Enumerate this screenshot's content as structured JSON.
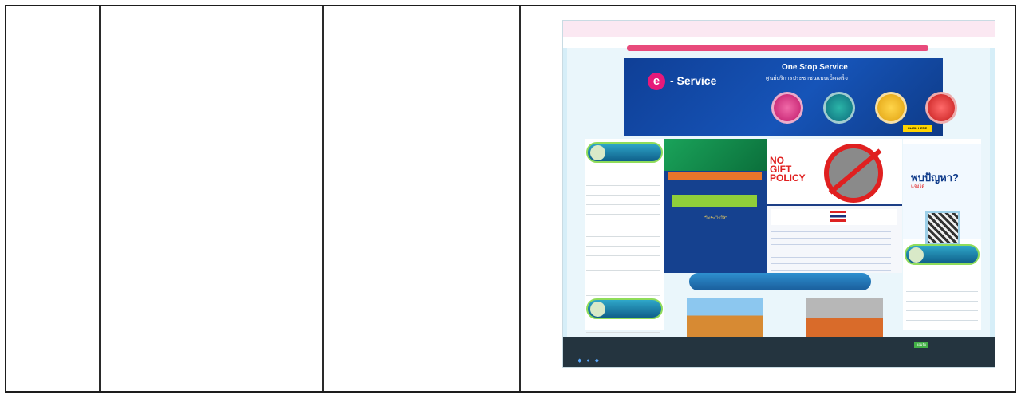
{
  "banner": {
    "e_logo": "e",
    "e_label": "- Service",
    "title": "One Stop Service",
    "subtitle": "ศูนย์บริการประชาชนแบบเบ็ดเสร็จ",
    "click_here": "CLICK HERE"
  },
  "poster": {
    "no_gift_line1": "NO",
    "no_gift_line2": "GIFT",
    "no_gift_line3": "POLICY",
    "thai_text": "\"ไม่รับ ไม่ให้\""
  },
  "help": {
    "heading": "พบปัญหา?",
    "subheading": "แจ้งได้"
  },
  "footer": {
    "accept": "ยอมรับ"
  }
}
